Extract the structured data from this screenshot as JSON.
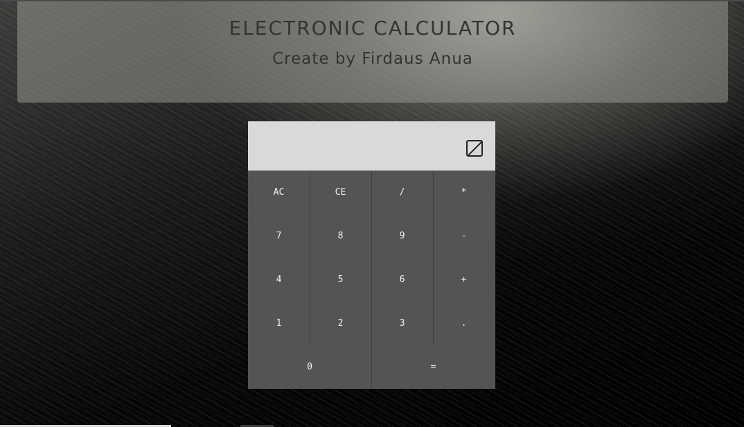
{
  "header": {
    "title": "ELECTRONIC CALCULATOR",
    "subtitle": "Create by Firdaus Anua"
  },
  "calculator": {
    "display": {
      "value": "",
      "icon": "zero-slashed-icon"
    },
    "keys": {
      "ac": "AC",
      "ce": "CE",
      "divide": "/",
      "multiply": "*",
      "seven": "7",
      "eight": "8",
      "nine": "9",
      "minus": "-",
      "four": "4",
      "five": "5",
      "six": "6",
      "plus": "+",
      "one": "1",
      "two": "2",
      "three": "3",
      "dot": ".",
      "zero": "0",
      "equals": "="
    }
  },
  "colors": {
    "header_text": "#333333",
    "display_bg": "#d9d9d9",
    "keypad_bg": "#545454",
    "key_text": "#f2f2f2"
  }
}
